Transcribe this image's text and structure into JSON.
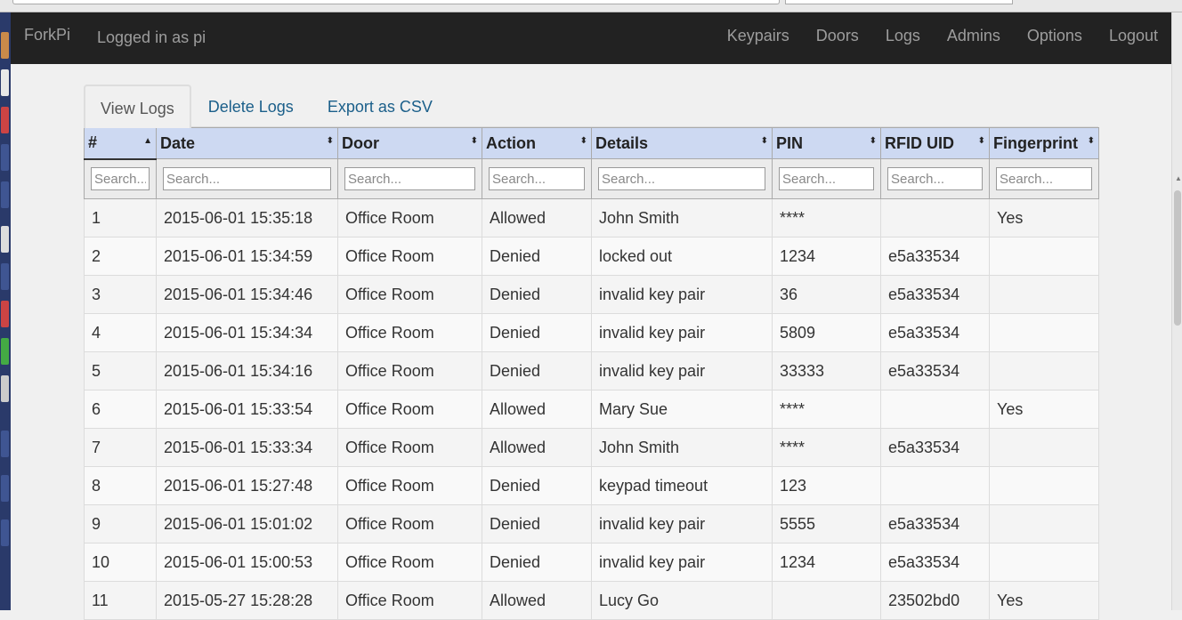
{
  "navbar": {
    "brand": "ForkPi",
    "login_text": "Logged in as pi",
    "links": [
      "Keypairs",
      "Doors",
      "Logs",
      "Admins",
      "Options",
      "Logout"
    ]
  },
  "tabs": [
    "View Logs",
    "Delete Logs",
    "Export as CSV"
  ],
  "table": {
    "columns": [
      "#",
      "Date",
      "Door",
      "Action",
      "Details",
      "PIN",
      "RFID UID",
      "Fingerprint"
    ],
    "filter_placeholder": "Search...",
    "rows": [
      [
        "1",
        "2015-06-01 15:35:18",
        "Office Room",
        "Allowed",
        "John Smith",
        "****",
        "",
        "Yes"
      ],
      [
        "2",
        "2015-06-01 15:34:59",
        "Office Room",
        "Denied",
        "locked out",
        "1234",
        "e5a33534",
        ""
      ],
      [
        "3",
        "2015-06-01 15:34:46",
        "Office Room",
        "Denied",
        "invalid key pair",
        "36",
        "e5a33534",
        ""
      ],
      [
        "4",
        "2015-06-01 15:34:34",
        "Office Room",
        "Denied",
        "invalid key pair",
        "5809",
        "e5a33534",
        ""
      ],
      [
        "5",
        "2015-06-01 15:34:16",
        "Office Room",
        "Denied",
        "invalid key pair",
        "33333",
        "e5a33534",
        ""
      ],
      [
        "6",
        "2015-06-01 15:33:54",
        "Office Room",
        "Allowed",
        "Mary Sue",
        "****",
        "",
        "Yes"
      ],
      [
        "7",
        "2015-06-01 15:33:34",
        "Office Room",
        "Allowed",
        "John Smith",
        "****",
        "e5a33534",
        ""
      ],
      [
        "8",
        "2015-06-01 15:27:48",
        "Office Room",
        "Denied",
        "keypad timeout",
        "123",
        "",
        ""
      ],
      [
        "9",
        "2015-06-01 15:01:02",
        "Office Room",
        "Denied",
        "invalid key pair",
        "5555",
        "e5a33534",
        ""
      ],
      [
        "10",
        "2015-06-01 15:00:53",
        "Office Room",
        "Denied",
        "invalid key pair",
        "1234",
        "e5a33534",
        ""
      ],
      [
        "11",
        "2015-05-27 15:28:28",
        "Office Room",
        "Allowed",
        "Lucy Go",
        "",
        "23502bd0",
        "Yes"
      ]
    ]
  },
  "colors": {
    "navbar_bg": "#222222",
    "header_bg": "#cdd9f2",
    "link": "#1b5f8a"
  }
}
